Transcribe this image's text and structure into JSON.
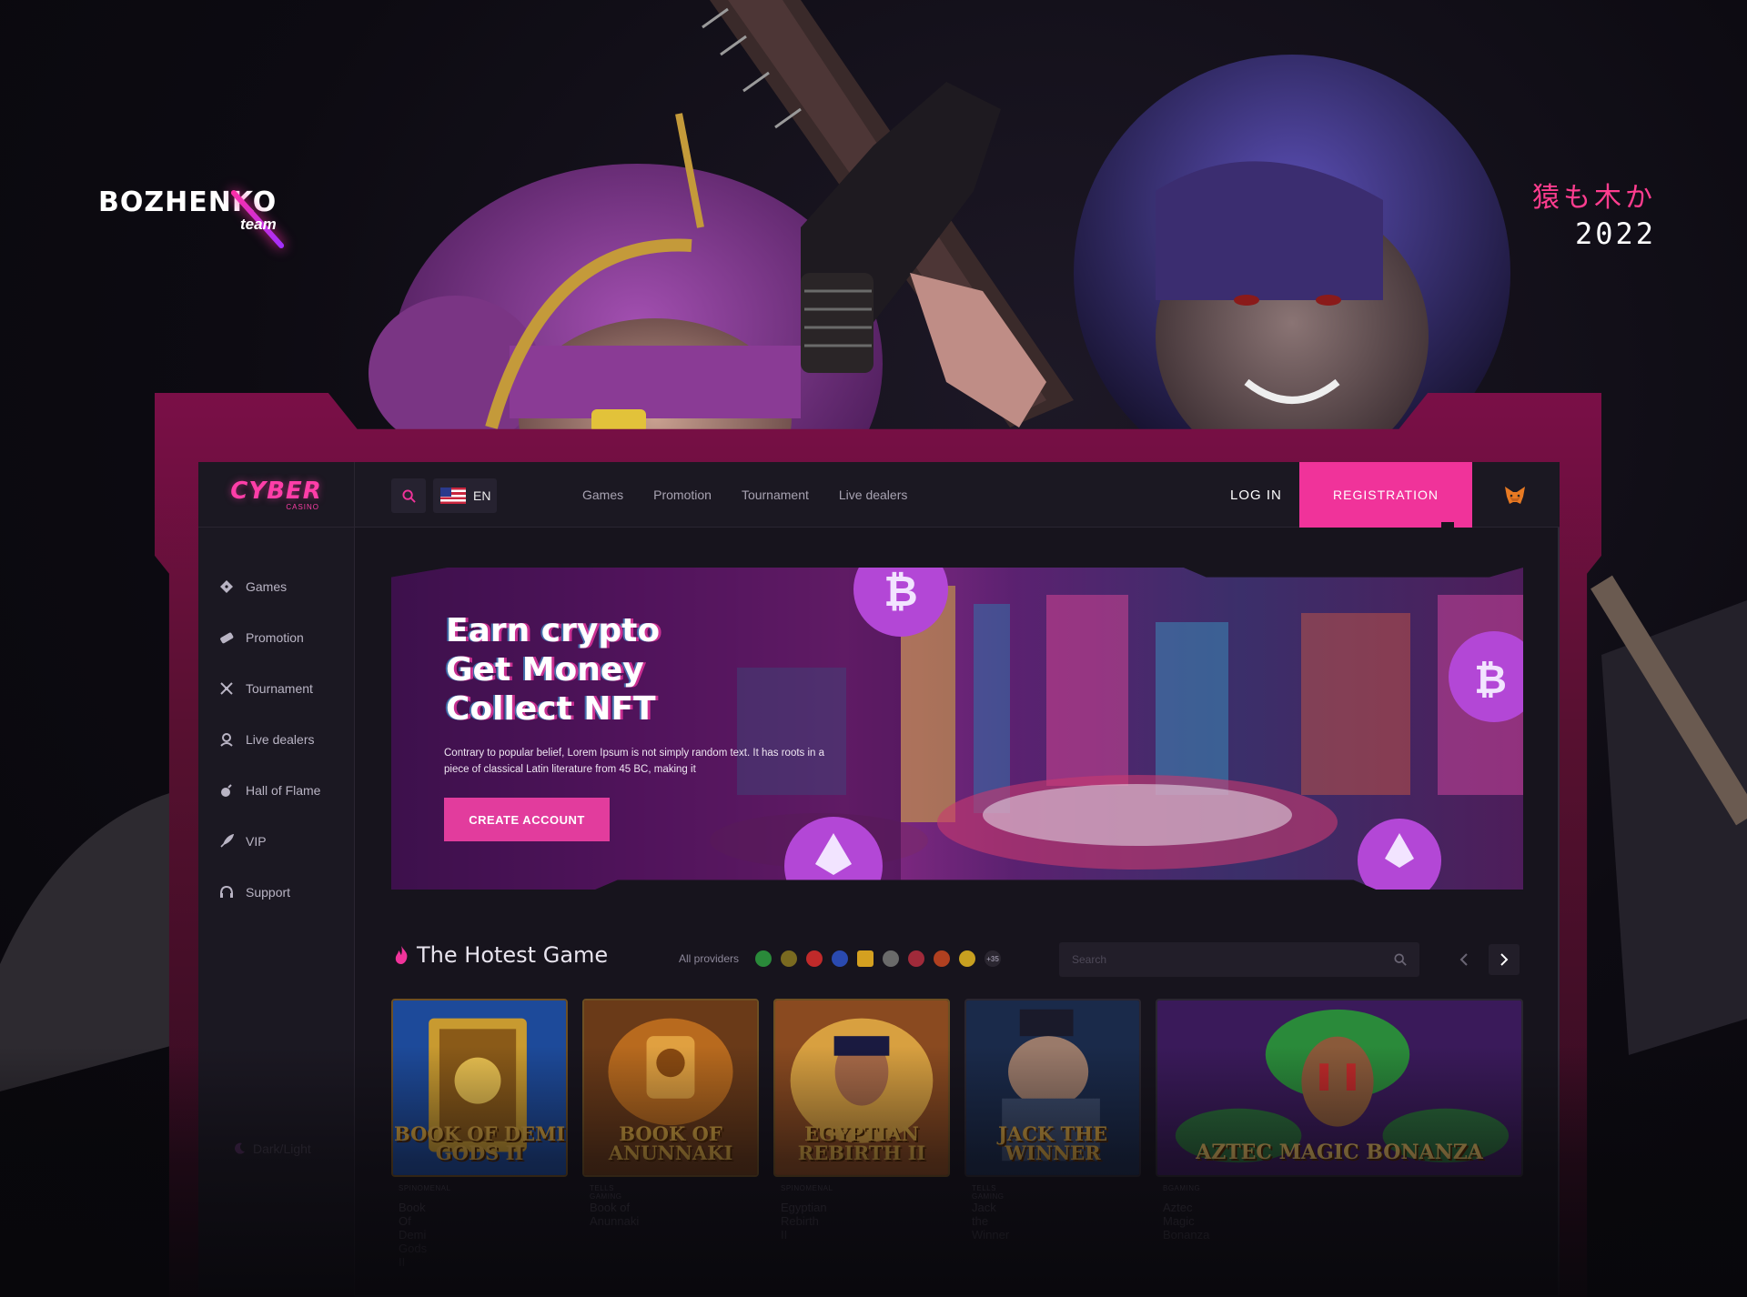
{
  "presentation": {
    "brand_name": "BOZHENKO",
    "brand_sub": "team",
    "motto_jp": "猿も木か",
    "year": "2022"
  },
  "header": {
    "logo_main": "CYBER",
    "logo_sub": "CASINO",
    "lang_code": "EN",
    "nav": [
      "Games",
      "Promotion",
      "Tournament",
      "Live dealers"
    ],
    "login_label": "LOG IN",
    "register_label": "REGISTRATION"
  },
  "sidebar": {
    "items": [
      {
        "label": "Games",
        "icon": "dice-icon"
      },
      {
        "label": "Promotion",
        "icon": "ticket-icon"
      },
      {
        "label": "Tournament",
        "icon": "trophy-icon"
      },
      {
        "label": "Live dealers",
        "icon": "dealer-icon"
      },
      {
        "label": "Hall of Flame",
        "icon": "bomb-icon"
      },
      {
        "label": "VIP",
        "icon": "rocket-icon"
      },
      {
        "label": "Support",
        "icon": "headset-icon"
      }
    ],
    "theme_toggle_label": "Dark/Light"
  },
  "hero": {
    "title_line1": "Earn crypto",
    "title_line2": "Get Money",
    "title_line3": "Collect NFT",
    "text": "Contrary to popular belief, Lorem Ipsum is not simply random text. It has roots in a piece of classical Latin literature from 45 BC, making it",
    "cta_label": "CREATE ACCOUNT"
  },
  "hottest": {
    "title": "The Hotest Game",
    "providers_label": "All providers",
    "providers_more": "+35",
    "search_placeholder": "Search"
  },
  "games": [
    {
      "art_title": "BOOK OF DEMI GODS II",
      "provider": "SPINOMENAL",
      "title": "Book Of Demi Gods II"
    },
    {
      "art_title": "BOOK OF ANUNNAKI",
      "provider": "TELLS GAMING",
      "title": "Book of Anunnaki"
    },
    {
      "art_title": "EGYPTIAN REBIRTH II",
      "provider": "SPINOMENAL",
      "title": "Egyptian Rebirth II"
    },
    {
      "art_title": "JACK THE WINNER",
      "provider": "TELLS GAMING",
      "title": "Jack the Winner"
    },
    {
      "art_title": "AZTEC MAGIC BONANZA",
      "provider": "BGAMING",
      "title": "Aztec Magic Bonanza"
    }
  ],
  "colors": {
    "accent": "#f0339a",
    "frame": "#7a0f47",
    "background": "#0d0b12",
    "panel": "#1b1822"
  }
}
